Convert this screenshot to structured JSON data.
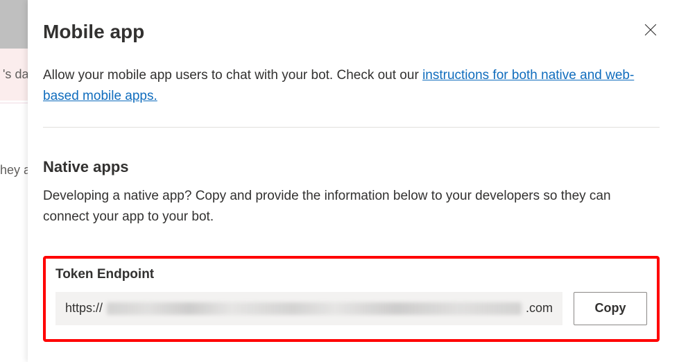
{
  "backdrop": {
    "pink_text": "'s dat",
    "grey_text": "hey a"
  },
  "panel": {
    "title": "Mobile app",
    "description_prefix": "Allow your mobile app users to chat with your bot. Check out our ",
    "link_text": "instructions for both native and web-based mobile apps.",
    "native": {
      "title": "Native apps",
      "description": "Developing a native app? Copy and provide the information below to your developers so they can connect your app to your bot."
    },
    "endpoint": {
      "label": "Token Endpoint",
      "value_prefix": "https://",
      "value_suffix": ".com",
      "copy_label": "Copy"
    }
  }
}
